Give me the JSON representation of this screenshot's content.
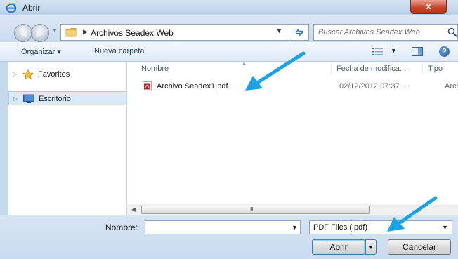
{
  "window": {
    "title": "Abrir",
    "close_label": "x"
  },
  "address": {
    "path": "Archivos Seadex Web",
    "search_placeholder": "Buscar Archivos Seadex Web"
  },
  "toolbar": {
    "organize_label": "Organizar ▾",
    "new_folder_label": "Nueva carpeta"
  },
  "navigation": {
    "items": [
      {
        "label": "Favoritos",
        "icon": "star-icon"
      },
      {
        "label": "Escritorio",
        "icon": "desktop-icon"
      }
    ]
  },
  "filelist": {
    "columns": [
      "Nombre",
      "Fecha de modifica...",
      "Tipo"
    ],
    "files": [
      {
        "name": "Archivo Seadex1.pdf",
        "date": "02/12/2012 07:37 ...",
        "type": "Archivo",
        "icon": "pdf-icon"
      }
    ]
  },
  "scrollbar": {
    "grip": "III"
  },
  "footer": {
    "name_label": "Nombre:",
    "name_value": "",
    "filter_value": "PDF Files (.pdf)",
    "open_label": "Abrir",
    "cancel_label": "Cancelar"
  },
  "colors": {
    "chrome": "#c6d8ec",
    "annotation_arrow": "#1aa3e8",
    "close_button": "#c8452d"
  }
}
